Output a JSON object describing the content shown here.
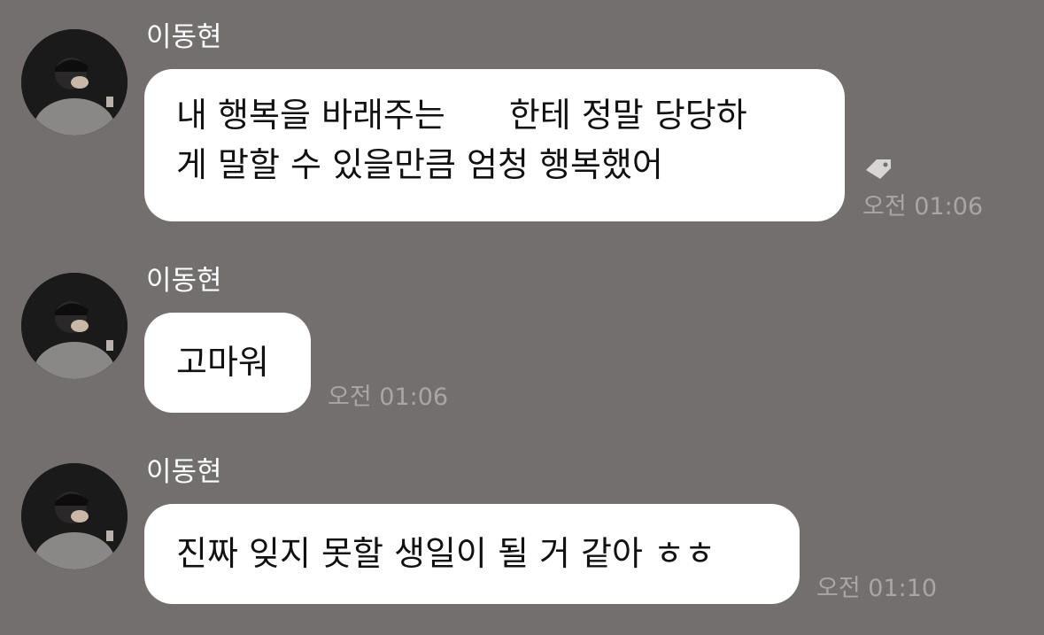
{
  "messages": [
    {
      "sender": "이동현",
      "text_line1_a": "내 행복을 바래주는",
      "text_line1_b": "한테 정말 당당하",
      "text_line2": "게 말할 수 있을만큼 엄청 행복했어",
      "time": "오전 01:06",
      "has_tag_icon": true
    },
    {
      "sender": "이동현",
      "text": "고마워",
      "time": "오전 01:06"
    },
    {
      "sender": "이동현",
      "text": "진짜 잊지 못할 생일이 될 거 같아 ㅎㅎ",
      "time": "오전 01:10"
    }
  ],
  "colors": {
    "background": "#736f6f",
    "bubble": "#ffffff",
    "timestamp": "#aaa6a6",
    "sender_name": "#ffffff"
  },
  "icons": [
    "profile-avatar",
    "tag-icon"
  ]
}
